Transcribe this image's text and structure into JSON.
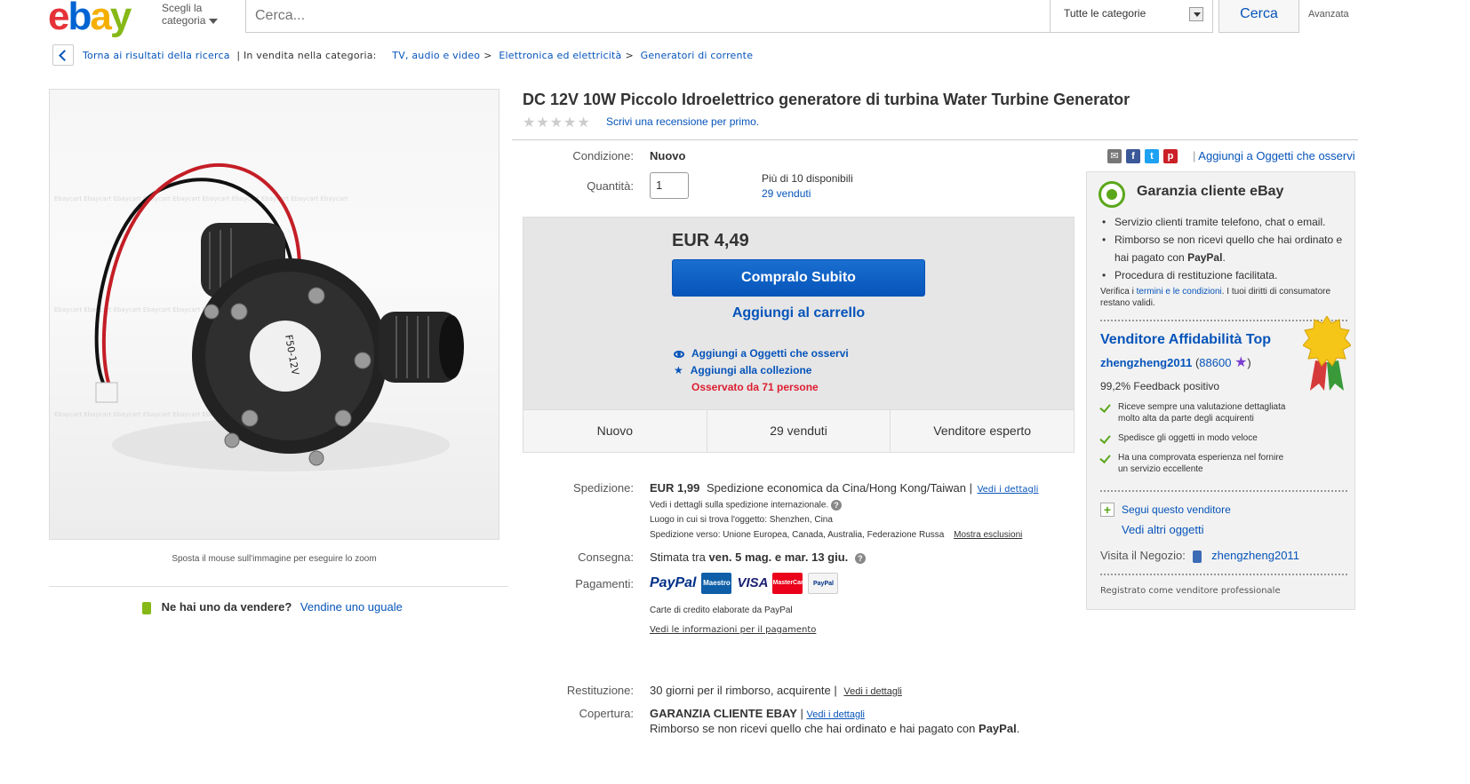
{
  "header": {
    "logo": "ebay",
    "category_picker": [
      "Scegli la",
      "categoria"
    ],
    "search_placeholder": "Cerca...",
    "category_select": "Tutte le categorie",
    "search_button": "Cerca",
    "advanced": "Avanzata"
  },
  "breadcrumb": {
    "back": "Torna ai risultati della ricerca",
    "in_category": "| In vendita nella categoria:",
    "items": [
      "TV, audio e video",
      "Elettronica ed elettricità",
      "Generatori di corrente"
    ]
  },
  "gallery": {
    "zoom_hint": "Sposta il mouse sull'immagine per eseguire lo zoom",
    "sell_question": "Ne hai uno da vendere?",
    "sell_link": "Vendine uno uguale"
  },
  "item": {
    "title": "DC 12V 10W Piccolo Idroelettrico generatore di turbina Water Turbine Generator",
    "review_link": "Scrivi una recensione per primo.",
    "condition_label": "Condizione:",
    "condition_value": "Nuovo",
    "quantity_label": "Quantità:",
    "quantity_value": "1",
    "available": "Più di 10 disponibili",
    "sold_link": "29 venduti",
    "price": "EUR 4,49",
    "buy_now": "Compralo Subito",
    "add_cart": "Aggiungi al carrello",
    "watch_link": "Aggiungi a Oggetti che osservi",
    "collection_link": "Aggiungi alla collezione",
    "watched_by": "Osservato da 71 persone",
    "stats": [
      "Nuovo",
      "29 venduti",
      "Venditore esperto"
    ]
  },
  "shipping": {
    "label": "Spedizione:",
    "price": "EUR 1,99",
    "desc": "Spedizione economica da Cina/Hong Kong/Taiwan |",
    "details_link": "Vedi i dettagli",
    "intl": "Vedi i dettagli sulla spedizione internazionale.",
    "location": "Luogo in cui si trova l'oggetto: Shenzhen, Cina",
    "ships_to": "Spedizione verso: Unione Europea, Canada, Australia, Federazione Russa",
    "exclusions_link": "Mostra esclusioni",
    "delivery_label": "Consegna:",
    "delivery_prefix": "Stimata tra",
    "delivery_dates": "ven. 5 mag. e mar. 13 giu.",
    "payment_label": "Pagamenti:",
    "payment_note": "Carte di credito elaborate da PayPal",
    "payment_link": "Vedi le informazioni per il pagamento",
    "return_label": "Restituzione:",
    "return_text": "30 giorni per il rimborso, acquirente |",
    "return_link": "Vedi i dettagli",
    "coverage_label": "Copertura:",
    "coverage_title": "GARANZIA CLIENTE EBAY",
    "coverage_link": "Vedi i dettagli",
    "coverage_text": "Rimborso se non ricevi quello che hai ordinato e hai pagato con",
    "coverage_paypal": "PayPal",
    "coverage_end": "."
  },
  "payment_logos": [
    "PayPal",
    "Maestro",
    "VISA",
    "MasterCard",
    "PayPal"
  ],
  "sidebar": {
    "watch_link": "Aggiungi a Oggetti che osservi",
    "guarantee_title": "Garanzia cliente eBay",
    "guarantee_items": [
      "Servizio clienti tramite telefono, chat o email.",
      "Rimborso se non ricevi quello che hai ordinato e hai pagato con",
      "Procedura di restituzione facilitata."
    ],
    "guarantee_paypal": "PayPal",
    "verify_prefix": "Verifica i",
    "verify_link": "termini e le condizioni",
    "verify_suffix": ". I tuoi diritti di consumatore restano validi.",
    "seller_title": "Venditore Affidabilità Top",
    "seller_name": "zhengzheng2011",
    "seller_score": "88600",
    "feedback": "99,2% Feedback positivo",
    "checks": [
      "Riceve sempre una valutazione dettagliata molto alta da parte degli acquirenti",
      "Spedisce gli oggetti in modo veloce",
      "Ha una comprovata esperienza nel fornire un servizio eccellente"
    ],
    "follow": "Segui questo venditore",
    "other_items": "Vedi altri oggetti",
    "store_label": "Visita il Negozio:",
    "store_name": "zhengzheng2011",
    "registered": "Registrato come venditore professionale"
  },
  "colors": {
    "accent": "#0654ba",
    "green": "#5ba71b",
    "red": "#dd1e31"
  }
}
